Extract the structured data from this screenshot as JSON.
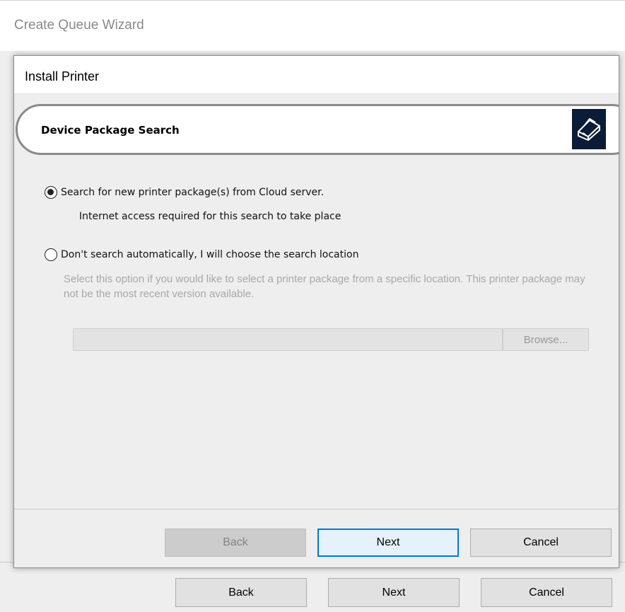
{
  "outer_window": {
    "title": "Create Queue Wizard",
    "buttons": {
      "back": "Back",
      "next": "Next",
      "cancel": "Cancel"
    }
  },
  "dialog": {
    "title": "Install Printer",
    "banner": {
      "title": "Device Package Search",
      "icon": "printer-icon"
    },
    "options": {
      "cloud": {
        "label": "Search for new printer package(s) from Cloud server.",
        "description": "Internet access required for this search to take place",
        "selected": true
      },
      "manual": {
        "label": "Don't search automatically, I will choose the search location",
        "description": "Select this option if you would like to select a printer package from a specific location. This printer package may not be the most recent version available.",
        "selected": false
      }
    },
    "path_input": {
      "value": ""
    },
    "browse_label": "Browse...",
    "buttons": {
      "back": "Back",
      "next": "Next",
      "cancel": "Cancel"
    }
  },
  "colors": {
    "accent": "#0078d7",
    "icon_background": "#0b1c36",
    "disabled_text": "#a8a8a8"
  }
}
